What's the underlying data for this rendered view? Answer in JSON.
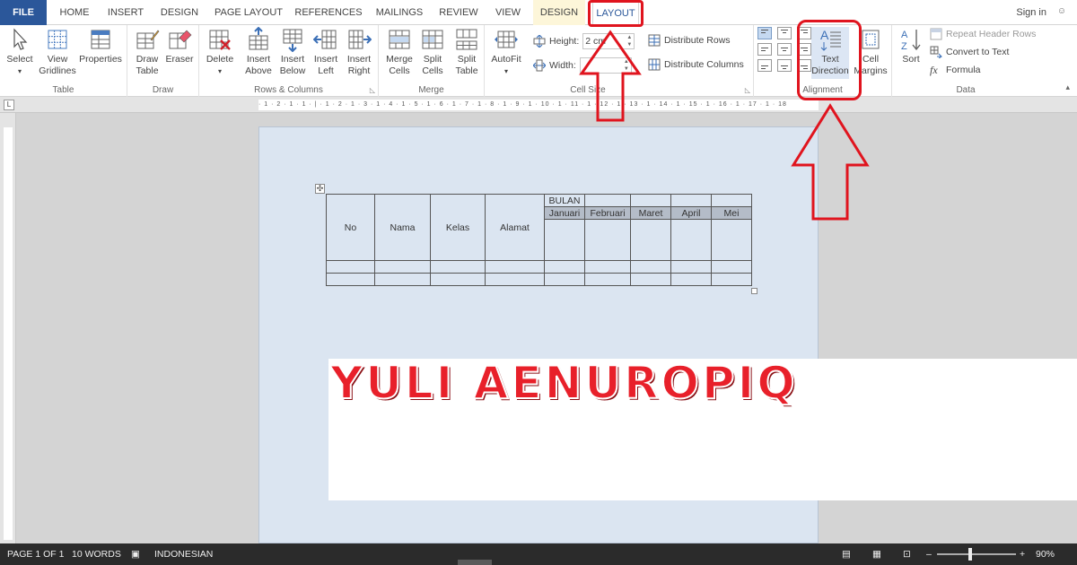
{
  "tabs": {
    "file": "FILE",
    "home": "HOME",
    "insert": "INSERT",
    "design": "DESIGN",
    "page_layout": "PAGE LAYOUT",
    "references": "REFERENCES",
    "mailings": "MAILINGS",
    "review": "REVIEW",
    "view": "VIEW",
    "table_design": "DESIGN",
    "table_layout": "LAYOUT"
  },
  "signin": "Sign in",
  "ribbon": {
    "table": {
      "label": "Table",
      "select": "Select",
      "view_gridlines": "View\nGridlines",
      "properties": "Properties"
    },
    "draw": {
      "label": "Draw",
      "draw_table": "Draw\nTable",
      "eraser": "Eraser"
    },
    "rows_columns": {
      "label": "Rows & Columns",
      "delete": "Delete",
      "insert_above": "Insert\nAbove",
      "insert_below": "Insert\nBelow",
      "insert_left": "Insert\nLeft",
      "insert_right": "Insert\nRight"
    },
    "merge": {
      "label": "Merge",
      "merge_cells": "Merge\nCells",
      "split_cells": "Split\nCells",
      "split_table": "Split\nTable"
    },
    "cell_size": {
      "label": "Cell Size",
      "autofit": "AutoFit",
      "height_label": "Height:",
      "height_value": "2 cm",
      "width_label": "Width:",
      "width_value": "",
      "distribute_rows": "Distribute Rows",
      "distribute_columns": "Distribute Columns"
    },
    "alignment": {
      "label": "Alignment",
      "text_direction": "Text\nDirection",
      "cell_margins": "Cell\nMargins"
    },
    "data": {
      "label": "Data",
      "sort": "Sort",
      "repeat_header_rows": "Repeat Header Rows",
      "convert_to_text": "Convert to Text",
      "formula": "Formula"
    }
  },
  "ruler_text": "· 1 · 2 · 1 · 1 · | · 1 · 2 · 1 · 3 · 1 · 4 · 1 · 5 · 1 · 6 · 1 · 7 · 1 · 8 · 1 · 9 · 1 · 10 · 1 · 11 · 1 · 12 · 1 · 13 · 1 · 14 · 1 · 15 · 1 · 16 · 1 · 17 · 1 · 18",
  "document_table": {
    "header_group": "BULAN",
    "columns": [
      "No",
      "Nama",
      "Kelas",
      "Alamat"
    ],
    "months": [
      "Januari",
      "Februari",
      "Maret",
      "April",
      "Mei"
    ]
  },
  "watermark": "YULI AENUROPIQ",
  "status": {
    "page": "PAGE 1 OF 1",
    "words": "10 WORDS",
    "language": "INDONESIAN",
    "zoom": "90%"
  },
  "colors": {
    "file_tab": "#2b579a",
    "annotation_red": "#e0141e",
    "page_bg": "#dbe5f1",
    "selected_cell": "#b4bcc8",
    "status_bar": "#2b2b2b"
  }
}
